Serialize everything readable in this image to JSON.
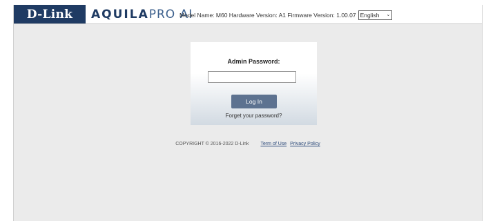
{
  "header": {
    "brand": "D-Link",
    "product_bold": "AQUILA",
    "product_light": "PRO AI",
    "info_text": "Model Name: M60 Hardware Version: A1 Firmware Version: 1.00.07",
    "language": "English"
  },
  "login": {
    "password_label": "Admin Password:",
    "password_value": "",
    "login_button": "Log In",
    "forget_link": "Forget your password?"
  },
  "footer": {
    "copyright": "COPYRIGHT © 2016-2022 D-Link",
    "terms": "Term of Use",
    "privacy": "Privacy Policy"
  },
  "colors": {
    "brand_bg": "#1f3b63",
    "button_bg": "#5d7290",
    "page_bg": "#ebebeb"
  }
}
